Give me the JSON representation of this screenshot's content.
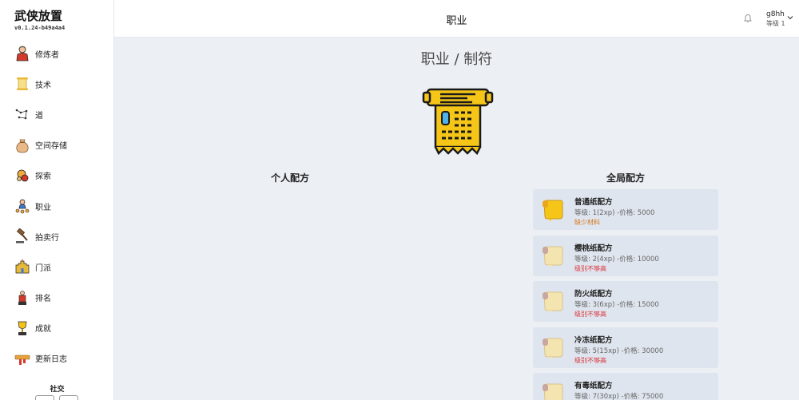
{
  "app": {
    "title": "武侠放置",
    "version": "v0.1.24-b49a4a4"
  },
  "nav": {
    "items": [
      {
        "label": "修炼者",
        "icon": "cultivator-icon"
      },
      {
        "label": "技术",
        "icon": "scroll-icon"
      },
      {
        "label": "道",
        "icon": "constellation-icon"
      },
      {
        "label": "空间存储",
        "icon": "bag-icon"
      },
      {
        "label": "探索",
        "icon": "explore-icon"
      },
      {
        "label": "职业",
        "icon": "profession-icon"
      },
      {
        "label": "拍卖行",
        "icon": "gavel-icon"
      },
      {
        "label": "门派",
        "icon": "castle-icon"
      },
      {
        "label": "排名",
        "icon": "ranking-icon"
      },
      {
        "label": "成就",
        "icon": "trophy-icon"
      },
      {
        "label": "更新日志",
        "icon": "changelog-icon"
      }
    ],
    "social_label": "社交"
  },
  "header": {
    "title": "职业",
    "user_name": "g8hh",
    "user_level": "等级 1"
  },
  "main": {
    "page_title": "职业 / 制符",
    "personal_title": "个人配方",
    "global_title": "全局配方",
    "recipes": [
      {
        "name": "普通纸配方",
        "meta": "等级:  1(2xp) -价格: 5000",
        "status": "缺少材料",
        "status_type": "warn",
        "active": true
      },
      {
        "name": "樱桃纸配方",
        "meta": "等级:  2(4xp) -价格: 10000",
        "status": "级别不够高",
        "status_type": "error",
        "active": false
      },
      {
        "name": "防火纸配方",
        "meta": "等级:  3(6xp) -价格: 15000",
        "status": "级别不够高",
        "status_type": "error",
        "active": false
      },
      {
        "name": "冷冻纸配方",
        "meta": "等级:  5(15xp) -价格: 30000",
        "status": "级别不够高",
        "status_type": "error",
        "active": false
      },
      {
        "name": "有毒纸配方",
        "meta": "等级:  7(30xp) -价格: 75000",
        "status": "",
        "status_type": "error",
        "active": false
      }
    ]
  },
  "colors": {
    "warn": "#d4761a",
    "error": "#d9363e",
    "scroll_gold": "#f5c518"
  }
}
